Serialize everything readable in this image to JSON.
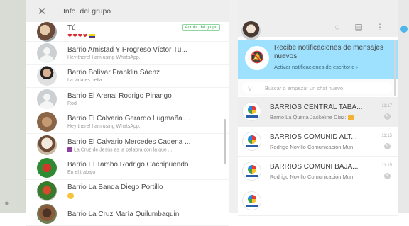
{
  "group_info": {
    "title": "Info. del grupo",
    "close_icon": "close-icon",
    "members": [
      {
        "name": "Tú",
        "status": "❤❤❤❤",
        "admin_badge": "Admin. del grupo",
        "avatar": "photo-a"
      },
      {
        "name": "Barrio Amistad Y Progreso Víctor Tu...",
        "status": "Hey there! I am using WhatsApp.",
        "avatar": "default"
      },
      {
        "name": "Barrio Bolívar Franklin Sáenz",
        "status": "La vida es bella",
        "avatar": "photo-b"
      },
      {
        "name": "Barrio El Arenal Rodrigo Pinango",
        "status": "Rod",
        "avatar": "default"
      },
      {
        "name": "Barrio El Calvario Gerardo Lugmaña ...",
        "status": "Hey there! I am using WhatsApp.",
        "avatar": "photo-g"
      },
      {
        "name": "Barrio El Calvario Mercedes Cadena ...",
        "status": "La Cruz de Jesús es la palabra con la que ...",
        "avatar": "photo-d"
      },
      {
        "name": "Barrio El Tambo Rodrigo Cachipuendo",
        "status": "En el trabajo",
        "avatar": "photo-e"
      },
      {
        "name": "Barrio La Banda Diego Portillo",
        "status": "",
        "avatar": "photo-f"
      },
      {
        "name": "Barrio La Cruz María Quilumbaquin",
        "status": "",
        "avatar": "photo-c"
      }
    ]
  },
  "chat_list": {
    "header_icons": [
      "status-icon",
      "new-chat-icon",
      "menu-icon"
    ],
    "notification": {
      "title": "Recibe notificaciones de mensajes nuevos",
      "link": "Activar notificaciones de escritorio ›"
    },
    "search_placeholder": "Buscar o empezar un chat nuevo",
    "chats": [
      {
        "name": "BARRIOS CENTRAL TABA...",
        "time": "11:17",
        "message": "Barrio La Quinta Jackeline Díaz:"
      },
      {
        "name": "BARRIOS COMUNID ALT...",
        "time": "11:15",
        "message": "Rodrigo Novillo Comunicación Mun"
      },
      {
        "name": "BARRIOS COMUNI BAJA...",
        "time": "11:15",
        "message": "Rodrigo Novillo Comunicación Mun"
      },
      {
        "name": "",
        "time": "",
        "message": ""
      }
    ]
  }
}
